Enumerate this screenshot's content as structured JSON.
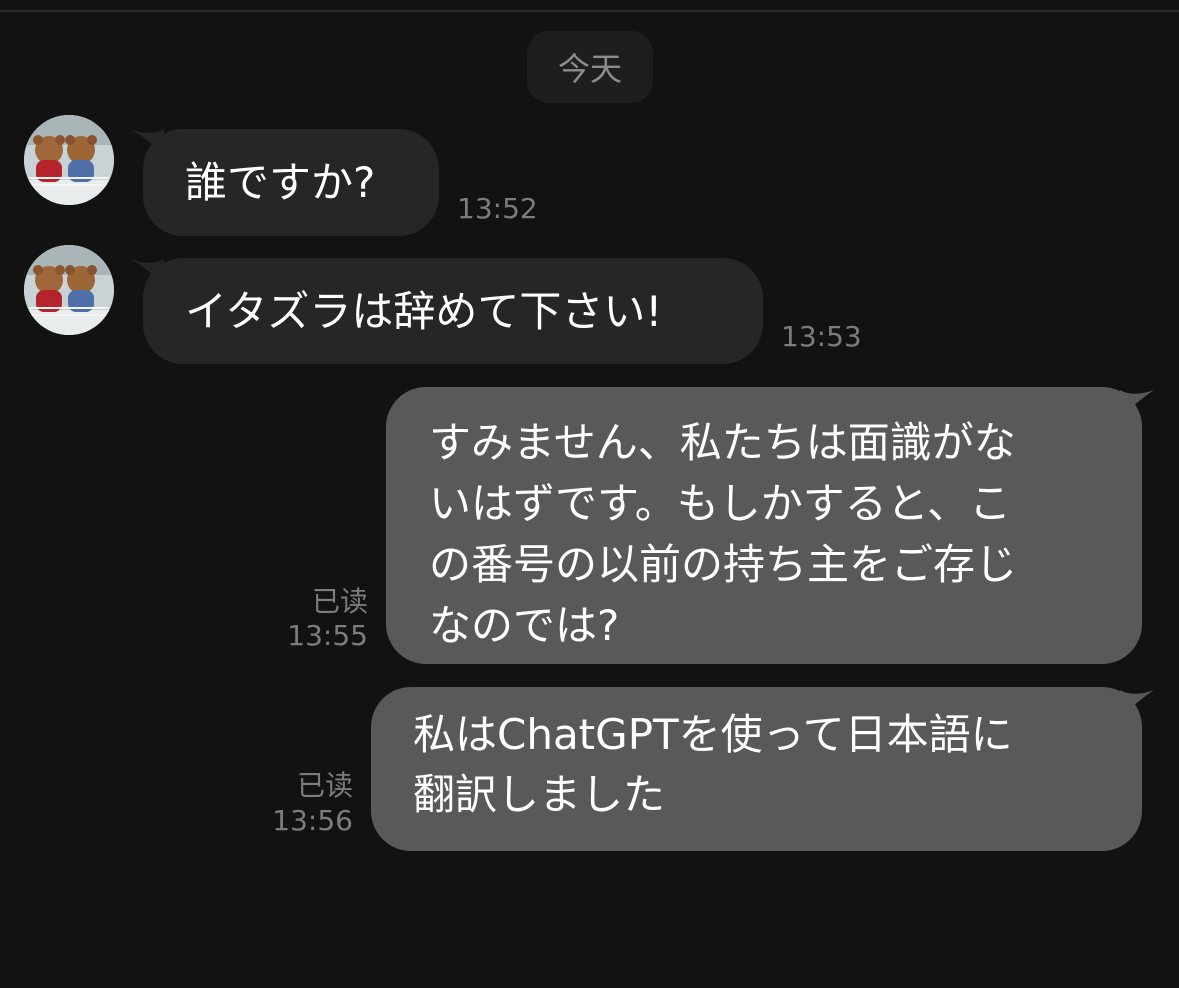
{
  "conversation": {
    "date_divider": "今天",
    "messages": [
      {
        "direction": "incoming",
        "text": "誰ですか?",
        "time": "13:52"
      },
      {
        "direction": "incoming",
        "text": "イタズラは辞めて下さい!",
        "time": "13:53"
      },
      {
        "direction": "outgoing",
        "lines": [
          "すみません、私たちは面識がな",
          "いはずです。もしかすると、こ",
          "の番号の以前の持ち主をご存じ",
          "なのでは?"
        ],
        "status": "已读",
        "time": "13:55"
      },
      {
        "direction": "outgoing",
        "lines": [
          "私はChatGPTを使って日本語に",
          "翻訳しました"
        ],
        "status": "已读",
        "time": "13:56"
      }
    ]
  },
  "colors": {
    "background": "#121212",
    "incoming_bubble": "#262626",
    "outgoing_bubble": "#595959",
    "meta_text": "#7c7c7c"
  },
  "icons": {
    "contact_avatar": "teddy-bears-avatar"
  }
}
